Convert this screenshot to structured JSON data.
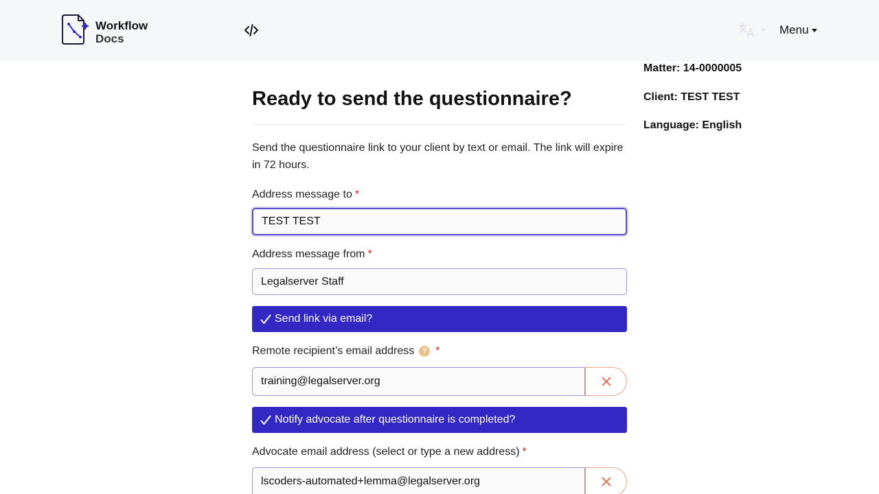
{
  "brand": {
    "title": "Workflow",
    "subtitle": "Docs"
  },
  "navbar": {
    "menu_label": "Menu"
  },
  "sidebar": {
    "matter": "Matter: 14-0000005",
    "client": "Client: TEST TEST",
    "language": "Language: English"
  },
  "main": {
    "title": "Ready to send the questionnaire?",
    "intro": "Send the questionnaire link to your client by text or email. The link will expire in 72 hours."
  },
  "form": {
    "to_label": "Address message to",
    "to_value": "TEST TEST",
    "from_label": "Address message from",
    "from_value": "Legalserver Staff",
    "send_email_label": "Send link via email?",
    "recipient_email_label": "Remote recipient’s email address",
    "recipient_email_help": "?",
    "recipient_email_value": "training@legalserver.org",
    "notify_label": "Notify advocate after questionnaire is completed?",
    "advocate_email_label": "Advocate email address (select or type a new address)",
    "advocate_email_value": "lscoders-automated+lemma@legalserver.org",
    "required_marker": "*"
  },
  "colors": {
    "accent": "#3328c3",
    "required": "#dc2626",
    "navbar_bg": "#f6f7f8",
    "clear_icon": "#e0735c",
    "help_icon": "#e9c28a"
  },
  "icons": {
    "logo": "workflow-docs-logo",
    "code": "code-icon",
    "language": "translate-icon",
    "check": "check-icon",
    "clear": "close-icon",
    "help": "question-circle-icon"
  }
}
